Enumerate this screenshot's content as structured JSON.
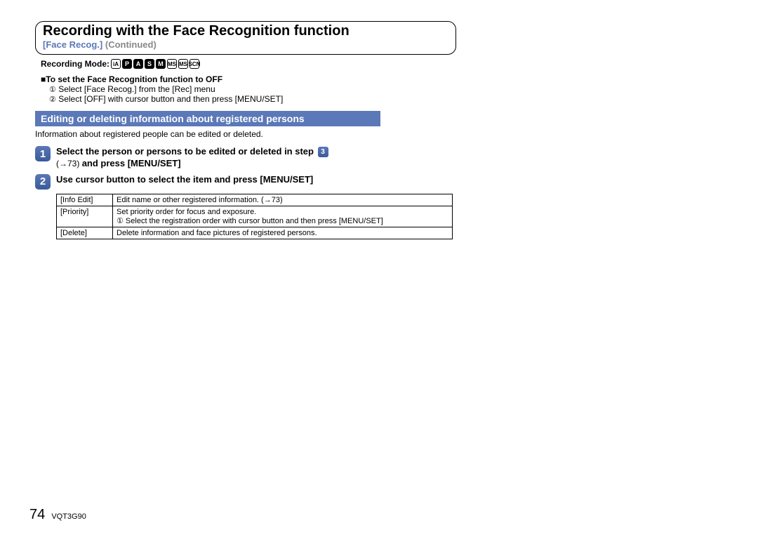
{
  "header": {
    "title": "Recording with the Face Recognition function",
    "tag": "[Face Recog.]",
    "continued": "(Continued)",
    "recmode_label": "Recording Mode:"
  },
  "modes": [
    "iA",
    "P",
    "A",
    "S",
    "M",
    "MS",
    "MS",
    "SCN"
  ],
  "off_section": {
    "heading": "■To set the Face Recognition function to OFF",
    "line1": " Select [Face Recog.] from the [Rec] menu",
    "line2": " Select [OFF] with cursor button and then press [MENU/SET]"
  },
  "band": "Editing or deleting information about registered persons",
  "intro": "Information about registered people can be edited or deleted.",
  "step1": {
    "num": "1",
    "text_a": "Select the person or persons to be edited or deleted in step ",
    "ref_num": "3",
    "text_b": "(→73) ",
    "text_c": "and press [MENU/SET]"
  },
  "step2": {
    "num": "2",
    "text": "Use cursor button to select the item and press [MENU/SET]"
  },
  "table": {
    "r1c1": "[Info Edit]",
    "r1c2": "Edit name or other registered information. (→73)",
    "r2c1": "[Priority]",
    "r2c2a": "Set priority order for focus and exposure.",
    "r2c2b": " Select the registration order with cursor button and then press [MENU/SET]",
    "r3c1": "[Delete]",
    "r3c2": "Delete information and face pictures of registered persons."
  },
  "footer": {
    "page": "74",
    "code": "VQT3G90"
  }
}
